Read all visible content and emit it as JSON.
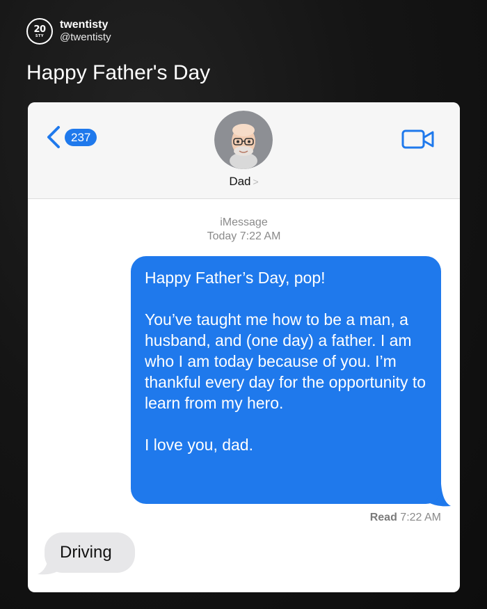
{
  "post": {
    "logo_number": "20",
    "logo_sub": "STY",
    "account_name": "twentisty",
    "account_handle": "@twentisty",
    "caption": "Happy Father's Day"
  },
  "navbar": {
    "back_count": "237",
    "contact_name": "Dad",
    "contact_chevron": ">",
    "accent_color": "#1f79ec",
    "icons": [
      "back-chevron-icon",
      "video-camera-icon",
      "memoji-avatar"
    ]
  },
  "thread": {
    "service": "iMessage",
    "timestamp": "Today 7:22 AM",
    "sent_message": "Happy Father’s Day, pop!\n\nYou’ve taught me how to be a man, a husband, and (one day) a father. I am who I am today because of you. I’m thankful every day for the opportunity to learn from my hero.\n\nI love you, dad.",
    "read_label": "Read",
    "read_time": "7:22 AM",
    "received_message": "Driving"
  }
}
